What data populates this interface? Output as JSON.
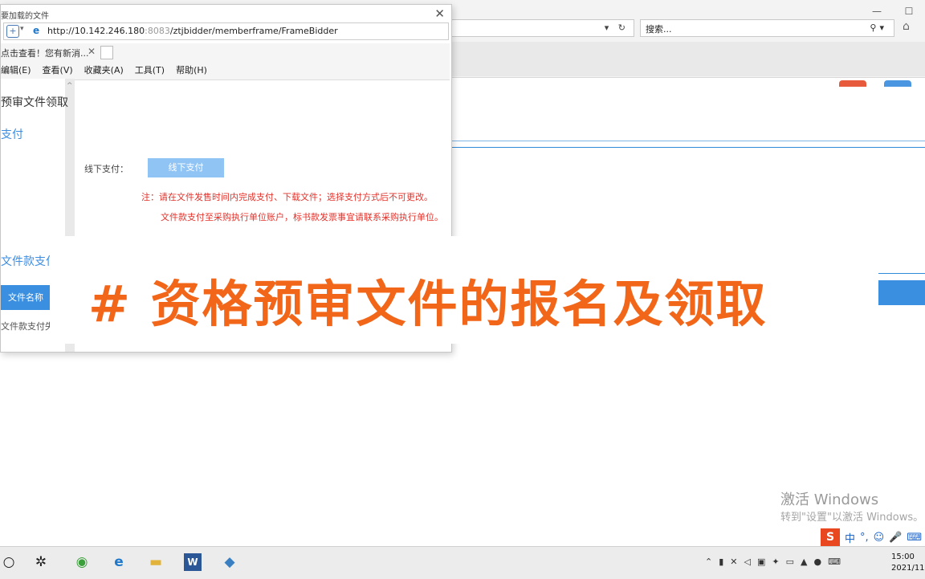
{
  "popup": {
    "title": "要加载的文件",
    "url_host": "http://10.142.246.180",
    "url_port": ":8083",
    "url_path": "/ztjbidder/memberframe/FrameBidder",
    "tab_text": "点击查看！您有新消...",
    "menu": [
      "编辑(E)",
      "查看(V)",
      "收藏夹(A)",
      "工具(T)",
      "帮助(H)"
    ]
  },
  "browser": {
    "search_placeholder": "搜索..."
  },
  "page": {
    "section_title": "预审文件领取",
    "pay_section": "支付",
    "pay_label": "线下支付：",
    "pay_button": "线下支付",
    "note_line1": "注：请在文件发售时间内完成支付、下载文件；选择支付方式后不可更改。",
    "note_line2": "文件款支付至采购执行单位账户，标书款发票事宜请联系采购执行单位。",
    "fee_section": "文件款支付",
    "col_file_name": "文件名称",
    "fee_note": "文件款支付失"
  },
  "banner": {
    "text": "# 资格预审文件的报名及领取"
  },
  "watermark": {
    "line1": "激活 Windows",
    "line2": "转到\"设置\"以激活 Windows。"
  },
  "ime": {
    "logo": "S",
    "lang": "中",
    "punct": "°,"
  },
  "taskbar": {
    "time": "15:00",
    "date": "2021/11"
  }
}
